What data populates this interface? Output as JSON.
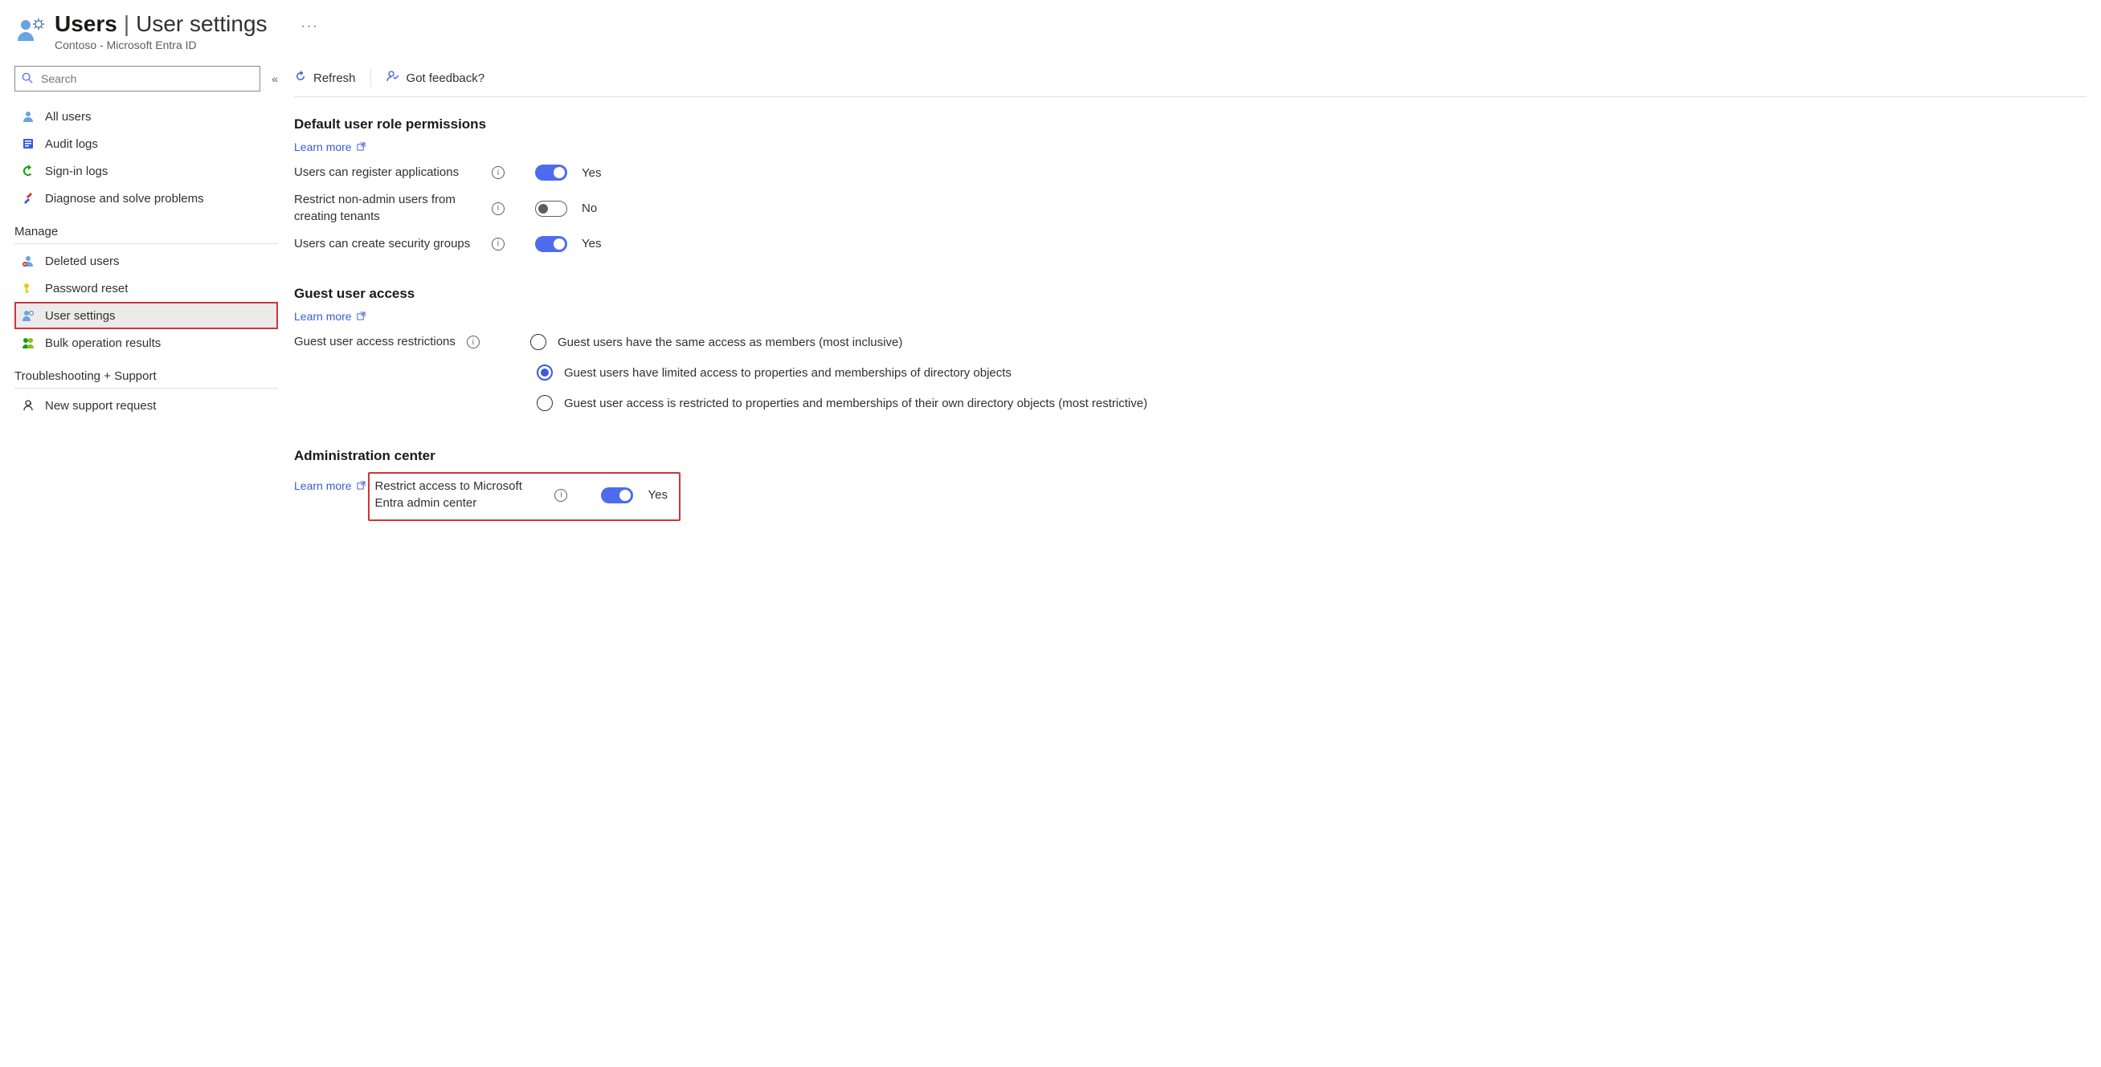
{
  "header": {
    "title_strong": "Users",
    "title_light": "User settings",
    "subtitle": "Contoso - Microsoft Entra ID"
  },
  "search": {
    "placeholder": "Search"
  },
  "nav_top": [
    {
      "label": "All users"
    },
    {
      "label": "Audit logs"
    },
    {
      "label": "Sign-in logs"
    },
    {
      "label": "Diagnose and solve problems"
    }
  ],
  "nav_manage_hdr": "Manage",
  "nav_manage": [
    {
      "label": "Deleted users"
    },
    {
      "label": "Password reset"
    },
    {
      "label": "User settings"
    },
    {
      "label": "Bulk operation results"
    }
  ],
  "nav_ts_hdr": "Troubleshooting + Support",
  "nav_ts": [
    {
      "label": "New support request"
    }
  ],
  "toolbar": {
    "refresh": "Refresh",
    "feedback": "Got feedback?"
  },
  "sect1": {
    "title": "Default user role permissions",
    "learn": "Learn more",
    "r1_label": "Users can register applications",
    "r1_val": "Yes",
    "r2_label": "Restrict non-admin users from creating tenants",
    "r2_val": "No",
    "r3_label": "Users can create security groups",
    "r3_val": "Yes"
  },
  "sect2": {
    "title": "Guest user access",
    "learn": "Learn more",
    "label": "Guest user access restrictions",
    "opt1": "Guest users have the same access as members (most inclusive)",
    "opt2": "Guest users have limited access to properties and memberships of directory objects",
    "opt3": "Guest user access is restricted to properties and memberships of their own directory objects (most restrictive)"
  },
  "sect3": {
    "title": "Administration center",
    "learn": "Learn more",
    "r1_label": "Restrict access to Microsoft Entra admin center",
    "r1_val": "Yes"
  }
}
